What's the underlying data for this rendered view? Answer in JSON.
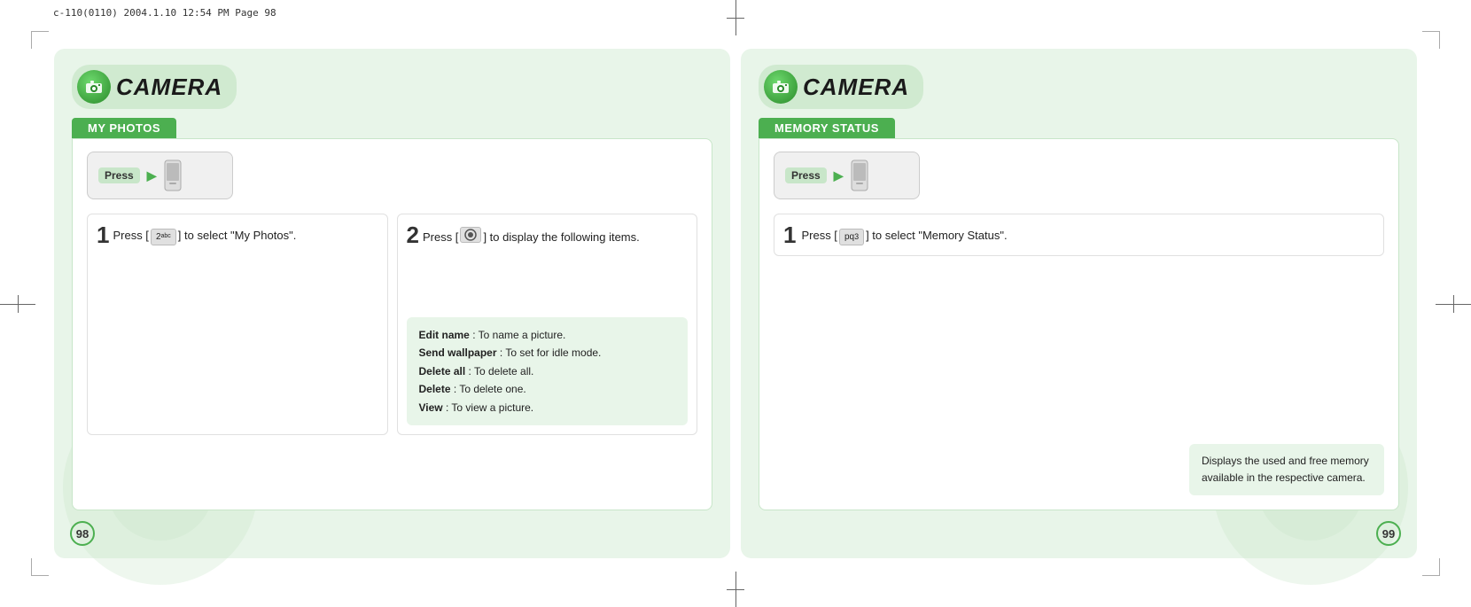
{
  "print_header": "c-110(0110)  2004.1.10  12:54 PM  Page 98",
  "page_left": {
    "camera_title": "CAMERA",
    "section_label": "MY PHOTOS",
    "press_label": "Press",
    "step1": {
      "number": "1",
      "text_before": "Press [",
      "key": "2abc",
      "text_after": "] to select \"My Photos\"."
    },
    "step2": {
      "number": "2",
      "text_before": "Press [",
      "key": "📷",
      "text_after": "] to display the following items."
    },
    "info_items": [
      {
        "bold": "Edit name",
        "text": " : To name a picture."
      },
      {
        "bold": "Send wallpaper",
        "text": " : To set for idle mode."
      },
      {
        "bold": "Delete all",
        "text": " : To delete all."
      },
      {
        "bold": "Delete",
        "text": " : To delete one."
      },
      {
        "bold": "View",
        "text": " : To view a picture."
      }
    ],
    "page_number": "98"
  },
  "page_right": {
    "camera_title": "CAMERA",
    "section_label": "MEMORY STATUS",
    "press_label": "Press",
    "step1": {
      "number": "1",
      "text_before": "Press [",
      "key": "pq3",
      "text_after": "] to select \"Memory Status\"."
    },
    "note_text": "Displays the used and free memory available in the respective camera.",
    "page_number": "99"
  }
}
